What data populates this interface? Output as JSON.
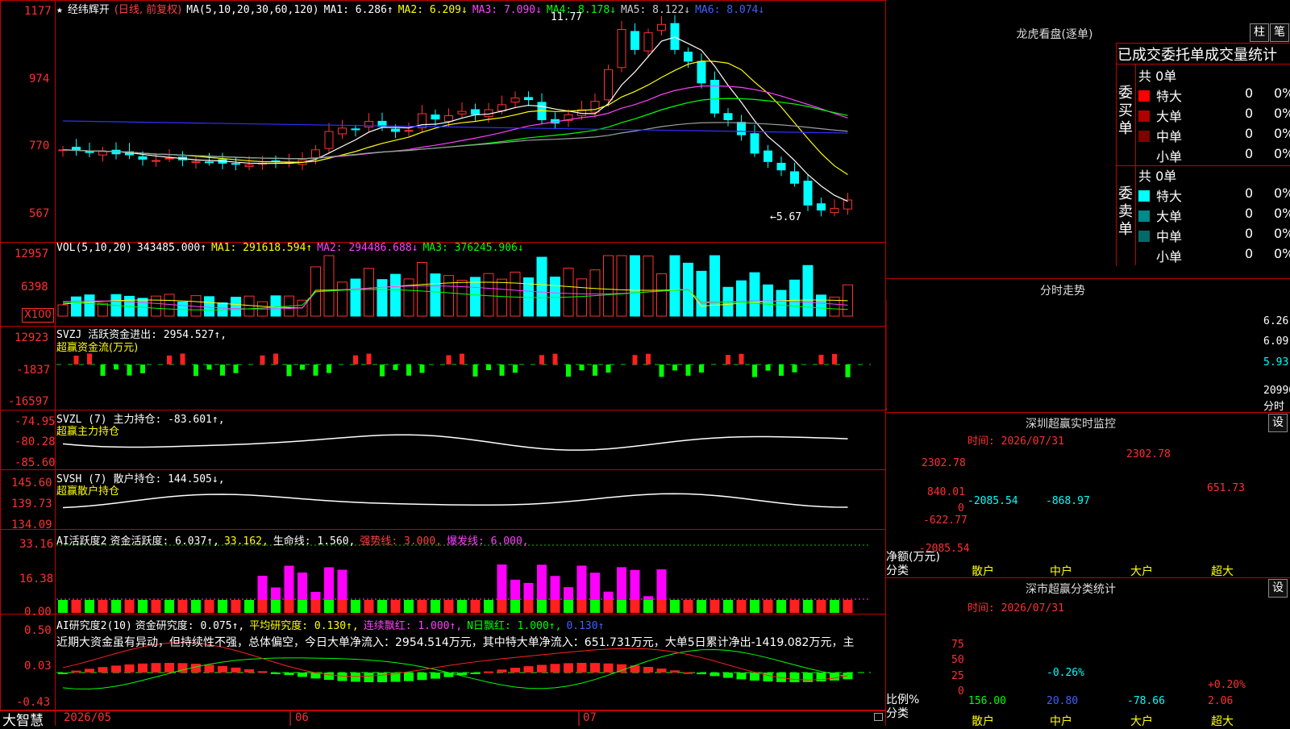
{
  "colors": {
    "up": "#ff3030",
    "down": "#00ffff",
    "grid": "#c00000",
    "ma1": "#ffffff",
    "ma2": "#ffff00",
    "ma3": "#ff40ff",
    "ma4": "#00ff00",
    "ma5": "#9aa0a0",
    "ma6": "#3030ff"
  },
  "main": {
    "title": "经纬辉开",
    "kind": "(日线, 前复权)",
    "ma_def": "MA(5,10,20,30,60,120)",
    "ma1": "MA1: 6.286↑",
    "ma2": "MA2: 6.209↓",
    "ma3": "MA3: 7.090↓",
    "ma4": "MA4: 8.178↓",
    "ma5": "MA5: 8.122↓",
    "ma6": "MA6: 8.074↓",
    "axis": [
      "1177",
      "974",
      "770",
      "567"
    ],
    "high_label": "11.77",
    "low_label": "←5.67"
  },
  "vol": {
    "def": "VOL(5,10,20)",
    "val": "343485.000↑",
    "ma1": "MA1: 291618.594↑",
    "ma2": "MA2: 294486.688↓",
    "ma3": "MA3: 376245.906↓",
    "axis": [
      "12957",
      "6398"
    ],
    "unit": "X100"
  },
  "svzj": {
    "line1": "SVZJ  活跃资金进出: 2954.527↑,",
    "line2": "超赢资金流(万元)",
    "axis": [
      "12923",
      "-1837",
      "-16597"
    ]
  },
  "svzl": {
    "line1": "SVZL (7) 主力持仓: -83.601↑,",
    "line2": "超赢主力持仓",
    "axis": [
      "-74.95",
      "-80.28",
      "-85.60"
    ]
  },
  "svsh": {
    "line1": "SVSH (7) 散户持仓: 144.505↓,",
    "line2": "超赢散户持仓",
    "axis": [
      "145.60",
      "139.73",
      "134.09"
    ]
  },
  "ai1": {
    "name": "AI活跃度2",
    "v1": "资金活跃度: 6.037↑,",
    "v2": "33.162,",
    "v3": "生命线: 1.560,",
    "v4": "强势线: 3.000,",
    "v5": "爆发线: 6.000,",
    "axis": [
      "33.16",
      "16.38",
      "0.00"
    ]
  },
  "ai2": {
    "name": "AI研究度2(10)",
    "v1": "资金研究度: 0.075↑,",
    "v2": "平均研究度: 0.130↑,",
    "v3": "连续飘红: 1.000↑,",
    "v4": "N日飘红: 1.000↑,",
    "v5": "0.130↑",
    "comment": "近期大资金虽有异动，但持续性不强，总体偏空，今日大单净流入：2954.514万元，其中特大单净流入：651.731万元，大单5日累计净出-1419.082万元，主",
    "axis": [
      "0.50",
      "0.03",
      "-0.43"
    ]
  },
  "bottom": {
    "brand": "大智慧",
    "d1": "2026/05",
    "d2": "06",
    "d3": "07"
  },
  "longhu": {
    "title": "龙虎看盘(逐单)",
    "btn1": "柱",
    "btn2": "笔",
    "header": "已成交委托单成交量统计",
    "buy_side": "委买单",
    "sell_side": "委卖单",
    "buy_total": "共 0单",
    "sell_total": "共 0单",
    "buy_rows": [
      {
        "label": "特大",
        "count": "0",
        "pct": "0%"
      },
      {
        "label": "大单",
        "count": "0",
        "pct": "0%"
      },
      {
        "label": "中单",
        "count": "0",
        "pct": "0%"
      },
      {
        "label": "小单",
        "count": "0",
        "pct": "0%"
      }
    ],
    "sell_rows": [
      {
        "label": "特大",
        "count": "0",
        "pct": "0%"
      },
      {
        "label": "大单",
        "count": "0",
        "pct": "0%"
      },
      {
        "label": "中单",
        "count": "0",
        "pct": "0%"
      },
      {
        "label": "小单",
        "count": "0",
        "pct": "0%"
      }
    ]
  },
  "intraday": {
    "title": "分时走势",
    "axis": [
      "6.26",
      "6.09",
      "5.93",
      "20996",
      "分时"
    ]
  },
  "sz_monitor": {
    "title": "深圳超赢实时监控",
    "btn": "设",
    "time": "时间: 2026/07/31",
    "axis": [
      "2302.78",
      "840.01",
      "0",
      "-622.77",
      "-2085.54"
    ],
    "ylabel1": "净额(万元)",
    "ylabel2": "分类",
    "bars": [
      {
        "cat": "散户",
        "value": -2085.54,
        "label": "-2085.54"
      },
      {
        "cat": "中户",
        "value": -868.97,
        "label": "-868.97"
      },
      {
        "cat": "大户",
        "value": 2302.78,
        "label": "2302.78"
      },
      {
        "cat": "超大",
        "value": 651.73,
        "label": "651.73"
      }
    ]
  },
  "sz_class": {
    "title": "深市超赢分类统计",
    "btn": "设",
    "time": "时间: 2026/07/31",
    "axis": [
      "75",
      "50",
      "25",
      "0"
    ],
    "ylabel1": "比例%",
    "ylabel2": "分类",
    "cats": [
      "散户",
      "中户",
      "大户",
      "超大"
    ],
    "values": [
      "156.00",
      "20.80",
      "-78.66",
      "2.06"
    ],
    "top_labels": [
      "",
      "-0.26%",
      "",
      "+0.20%"
    ]
  }
}
